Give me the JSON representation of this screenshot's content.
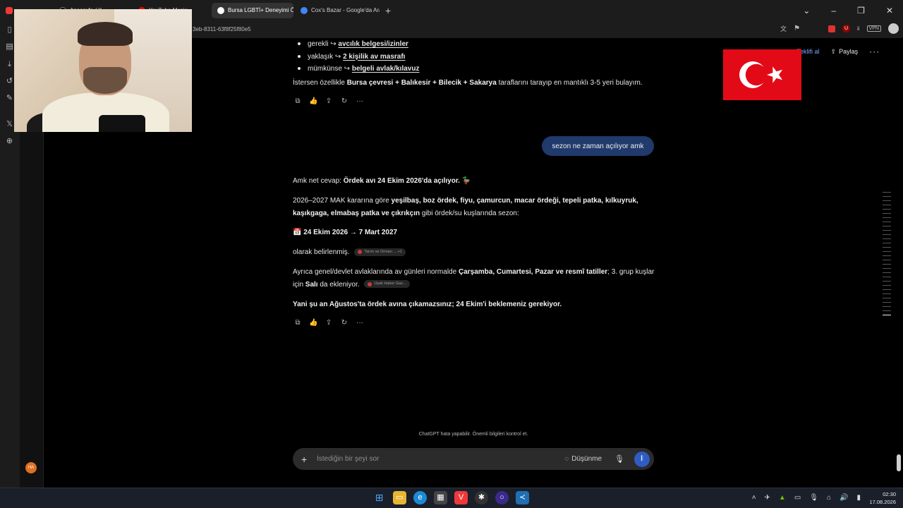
{
  "browser": {
    "tabs": [
      {
        "label": "",
        "color": "#ef3939"
      },
      {
        "label": "Anasayfa / X",
        "color": "#000000"
      },
      {
        "label": "YouTube Music",
        "color": "#ff0000"
      },
      {
        "label": "Bursa LGBTİ+ Deneyimi Öz",
        "color": "#ffffff"
      },
      {
        "label": "Cox's Bazar - Google'da Ara",
        "color": "#4285f4"
      }
    ],
    "url": "3eb-8311-63f8f25f80e5"
  },
  "header": {
    "teklif_label": "Teklifi al",
    "share_label": "Paylaş"
  },
  "assistant_prev": {
    "bullets": [
      {
        "prefix": "gerekli ↪",
        "link": "avcılık belgesi/izinler"
      },
      {
        "prefix": "yaklaşık ↪",
        "link": "2 kişilik av masrafı"
      },
      {
        "prefix": "mümkünse ↪",
        "link": "belgeli avlak/kılavuz"
      }
    ],
    "closing_a": "İstersen özellikle",
    "closing_bold": "Bursa çevresi + Balıkesir + Bilecik + Sakarya",
    "closing_b": "taraflarını tarayıp en mantıklı 3-5 yeri bulayım."
  },
  "user_message": "sezon ne zaman açılıyor amk",
  "assistant": {
    "p1_a": "Amk net cevap:",
    "p1_bold": "Ördek avı 24 Ekim 2026'da açılıyor.",
    "p1_emoji": "🦆",
    "p2_a": "2026–2027 MAK kararına göre",
    "p2_bold": "yeşilbaş, boz ördek, fiyu, çamurcun, macar ördeği, tepeli patka, kılkuyruk, kaşıkgaga, elmabaş patka ve çıkrıkçın",
    "p2_b": "gibi ördek/su kuşlarında sezon:",
    "p3_icon": "📅",
    "p3_bold": "24 Ekim 2026 → 7 Mart 2027",
    "p4": "olarak belirlenmiş.",
    "chip1": "Tarım ve Orman ... +1",
    "p5_a": "Ayrıca genel/devlet avlaklarında av günleri normalde",
    "p5_bold": "Çarşamba, Cumartesi, Pazar ve resmî tatiller",
    "p5_b": "; 3. grup kuşlar için",
    "p5_bold2": "Salı",
    "p5_c": "da ekleniyor.",
    "chip2": "Uşak Haber Gaz...",
    "p6": "Yani şu an Ağustos'ta ördek avına çıkamazsınız; 24 Ekim'i beklemeniz gerekiyor."
  },
  "disclaimer": "ChatGPT hata yapabilir. Önemli bilgileri kontrol et.",
  "composer": {
    "placeholder": "İstediğin bir şeyi sor",
    "think_label": "Düşünme"
  },
  "avatar_initials": "HA",
  "taskbar": {
    "time": "02:30",
    "date": "17.08.2026"
  }
}
